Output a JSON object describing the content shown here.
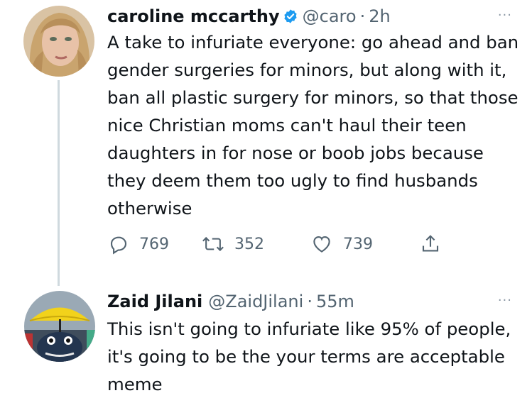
{
  "tweets": [
    {
      "name": "caroline mccarthy",
      "handle": "@caro",
      "time": "2h",
      "verified": true,
      "text": "A take to infuriate everyone: go ahead and ban gender surgeries for minors, but along with it, ban all plastic surgery for minors, so that those nice Christian moms can't haul their teen daughters in for nose or boob jobs because they deem them too ugly to find husbands otherwise",
      "replies": "769",
      "retweets": "352",
      "likes": "739"
    },
    {
      "name": "Zaid Jilani",
      "handle": "@ZaidJilani",
      "time": "55m",
      "text": "This isn't going to infuriate like 95% of people, it's going to be the your terms are acceptable meme"
    }
  ],
  "separator": "·",
  "more_icon": "···",
  "colors": {
    "verified": "#1d9bf0",
    "secondary": "#536471",
    "thread_line": "#cfd9de"
  }
}
